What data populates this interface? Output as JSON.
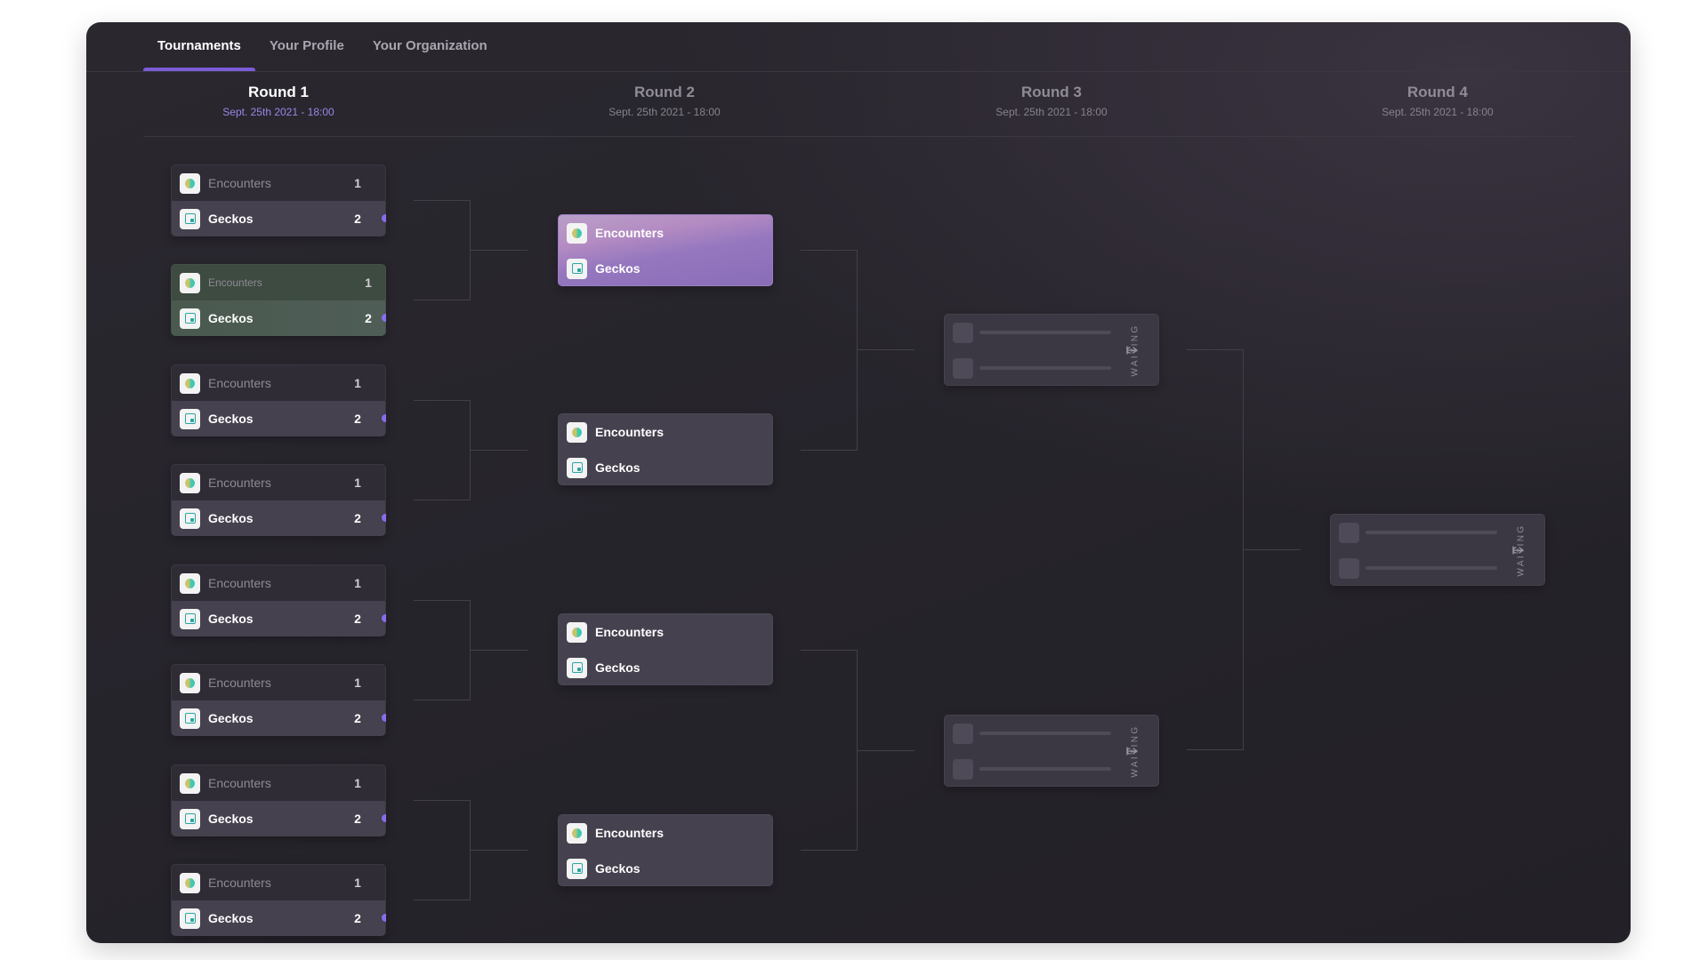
{
  "tabs": [
    {
      "label": "Tournaments",
      "active": true
    },
    {
      "label": "Your Profile",
      "active": false
    },
    {
      "label": "Your Organization",
      "active": false
    }
  ],
  "rounds": [
    {
      "title": "Round 1",
      "date": "Sept. 25th 2021 - 18:00",
      "active": true
    },
    {
      "title": "Round 2",
      "date": "Sept. 25th 2021 - 18:00",
      "active": false
    },
    {
      "title": "Round 3",
      "date": "Sept. 25th 2021 - 18:00",
      "active": false
    },
    {
      "title": "Round 4",
      "date": "Sept. 25th 2021 - 18:00",
      "active": false
    }
  ],
  "round1_matches": [
    {
      "team1": "Encounters",
      "score1": "1",
      "team2": "Geckos",
      "score2": "2",
      "style": "default"
    },
    {
      "team1": "Encounters",
      "score1": "1",
      "team2": "Geckos",
      "score2": "2",
      "style": "highlighted-green"
    },
    {
      "team1": "Encounters",
      "score1": "1",
      "team2": "Geckos",
      "score2": "2",
      "style": "default"
    },
    {
      "team1": "Encounters",
      "score1": "1",
      "team2": "Geckos",
      "score2": "2",
      "style": "default"
    },
    {
      "team1": "Encounters",
      "score1": "1",
      "team2": "Geckos",
      "score2": "2",
      "style": "default"
    },
    {
      "team1": "Encounters",
      "score1": "1",
      "team2": "Geckos",
      "score2": "2",
      "style": "default"
    },
    {
      "team1": "Encounters",
      "score1": "1",
      "team2": "Geckos",
      "score2": "2",
      "style": "default"
    },
    {
      "team1": "Encounters",
      "score1": "1",
      "team2": "Geckos",
      "score2": "2",
      "style": "default"
    }
  ],
  "round2_matches": [
    {
      "team1": "Encounters",
      "team2": "Geckos",
      "style": "highlighted-purple"
    },
    {
      "team1": "Encounters",
      "team2": "Geckos",
      "style": "default"
    },
    {
      "team1": "Encounters",
      "team2": "Geckos",
      "style": "default"
    },
    {
      "team1": "Encounters",
      "team2": "Geckos",
      "style": "default"
    }
  ],
  "round3_matches": [
    {
      "status": "WAITING"
    },
    {
      "status": "WAITING"
    }
  ],
  "round4_matches": [
    {
      "status": "WAITING"
    }
  ],
  "team_icons": {
    "Encounters": "orb-logo-icon",
    "Geckos": "square-logo-icon"
  },
  "colors": {
    "accent": "#7c5cd6",
    "winner_dot": "#8b6cf0",
    "highlight_green": "#3e4b40",
    "highlight_purple": "#9577bf"
  }
}
